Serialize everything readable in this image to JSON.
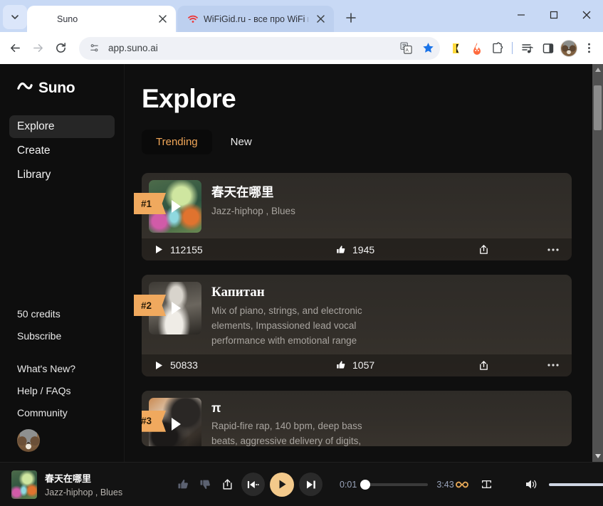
{
  "browser": {
    "tabs": [
      {
        "title": "Suno",
        "favicon": "suno-icon",
        "active": true
      },
      {
        "title": "WiFiGid.ru - все про WiFi и бес",
        "favicon": "wifi-icon",
        "active": false
      }
    ],
    "new_tab_label": "+",
    "address": "app.suno.ai",
    "omnibox_icons": [
      "site-settings-icon",
      "translate-icon",
      "bookmark-star-icon"
    ],
    "toolbar_icons": [
      "note-extension-icon",
      "fire-extension-icon",
      "extensions-puzzle-icon",
      "media-playlist-icon",
      "side-panel-icon",
      "profile-avatar-icon",
      "three-dot-menu-icon"
    ],
    "window_controls": [
      "minimize",
      "maximize",
      "close"
    ]
  },
  "sidebar": {
    "brand": "Suno",
    "nav": [
      {
        "label": "Explore",
        "active": true
      },
      {
        "label": "Create",
        "active": false
      },
      {
        "label": "Library",
        "active": false
      }
    ],
    "credits": "50 credits",
    "subscribe": "Subscribe",
    "links": [
      "What's New?",
      "Help / FAQs",
      "Community"
    ]
  },
  "main": {
    "title": "Explore",
    "tabs": [
      {
        "label": "Trending",
        "active": true
      },
      {
        "label": "New",
        "active": false
      }
    ],
    "cards": [
      {
        "rank": "#1",
        "title": "春天在哪里",
        "desc": "Jazz-hiphop , Blues",
        "plays": "112155",
        "likes": "1945",
        "art": "forest-stream-artwork"
      },
      {
        "rank": "#2",
        "title": "Капитан",
        "desc": "Mix of piano, strings, and electronic elements, Impassioned lead vocal performance with emotional range",
        "plays": "50833",
        "likes": "1057",
        "art": "sailing-ship-artwork"
      },
      {
        "rank": "#3",
        "title": "π",
        "desc": "Rapid-fire rap, 140 bpm, deep bass beats, aggressive delivery of digits,",
        "plays": "",
        "likes": "",
        "art": "machinery-artwork"
      }
    ]
  },
  "player": {
    "track_title": "春天在哪里",
    "track_subtitle": "Jazz-hiphop , Blues",
    "current_time": "0:01",
    "total_time": "3:43",
    "progress_percent": 1,
    "volume_percent": 97,
    "controls": [
      "thumbs-up-icon",
      "thumbs-down-icon",
      "share-icon",
      "previous-icon",
      "play-icon",
      "next-icon",
      "infinity-icon",
      "repeat-icon",
      "volume-icon"
    ],
    "accent_color": "#f3c98b"
  }
}
